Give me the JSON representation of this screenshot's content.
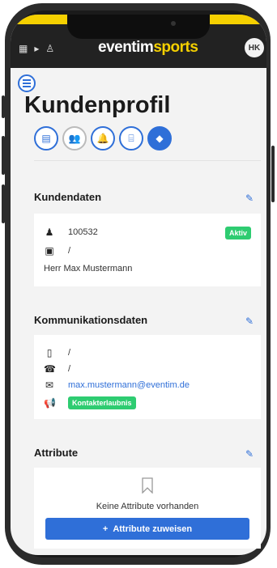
{
  "app": {
    "logo_main": "eventim",
    "logo_accent": "sports",
    "avatar": "HK"
  },
  "page": {
    "title": "Kundenprofil"
  },
  "sections": {
    "kundendaten": {
      "title": "Kundendaten",
      "customer_id": "100532",
      "status": "Aktiv",
      "company": "/",
      "name": "Herr Max Mustermann"
    },
    "kommunikation": {
      "title": "Kommunikationsdaten",
      "mobile": "/",
      "phone": "/",
      "email": "max.mustermann@eventim.de",
      "permission": "Kontakterlaubnis"
    },
    "attribute": {
      "title": "Attribute",
      "empty_text": "Keine Attribute vorhanden",
      "assign_button": "Attribute zuweisen"
    }
  },
  "colors": {
    "accent": "#2f6fd8",
    "brand_yellow": "#f5d000",
    "success": "#2ecc71"
  },
  "icons": [
    "menu-icon",
    "document-icon",
    "people-icon",
    "bell-icon",
    "tree-icon",
    "tag-icon",
    "edit-icon",
    "user-id-icon",
    "company-icon",
    "mobile-icon",
    "phone-icon",
    "email-icon",
    "megaphone-icon",
    "bookmark-icon",
    "plus-icon"
  ]
}
